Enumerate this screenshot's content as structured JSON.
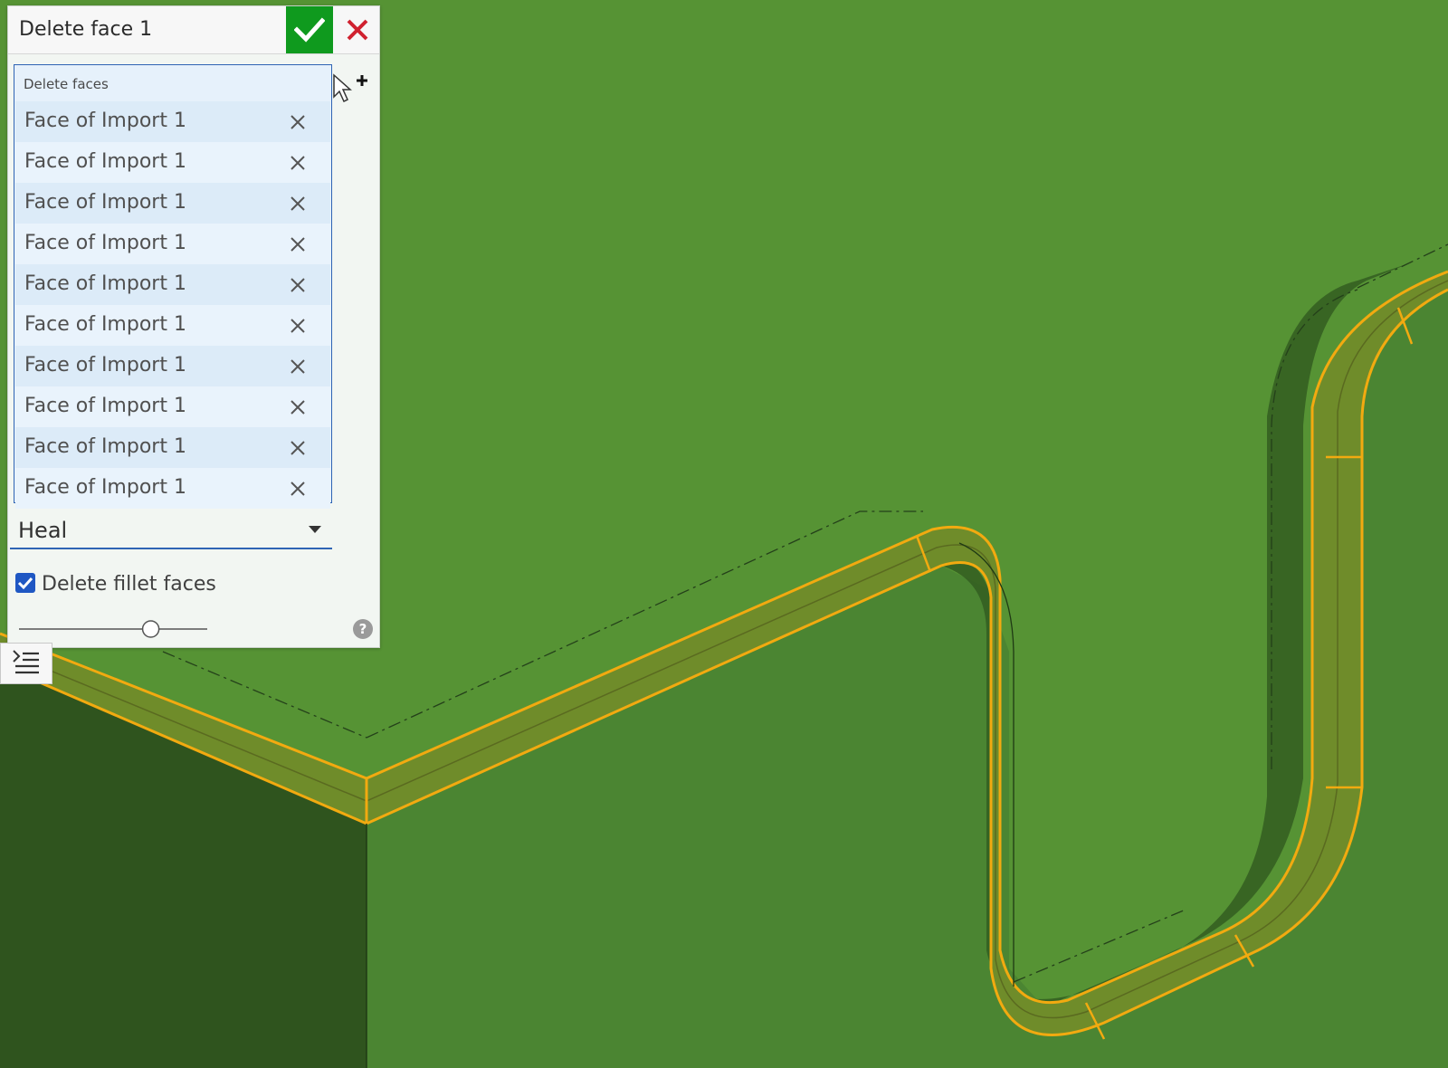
{
  "dialog": {
    "title": "Delete face 1",
    "faces_label": "Delete faces",
    "faces": [
      "Face of Import 1",
      "Face of Import 1",
      "Face of Import 1",
      "Face of Import 1",
      "Face of Import 1",
      "Face of Import 1",
      "Face of Import 1",
      "Face of Import 1",
      "Face of Import 1",
      "Face of Import 1"
    ],
    "mode": "Heal",
    "delete_fillet_label": "Delete fillet faces",
    "delete_fillet_checked": true,
    "slider_fraction": 0.7
  },
  "icons": {
    "accept": "check-icon",
    "cancel": "close-icon",
    "remove": "close-icon",
    "add_selection": "cursor-add-icon",
    "help": "help-icon",
    "feature_list": "feature-list-icon"
  },
  "colors": {
    "viewport": "#569334",
    "face_dark": "#2f541e",
    "highlight": "#f2aa10",
    "accept": "#0f9a1e",
    "cancel": "#d0212f",
    "selection_border": "#2f64b4"
  }
}
